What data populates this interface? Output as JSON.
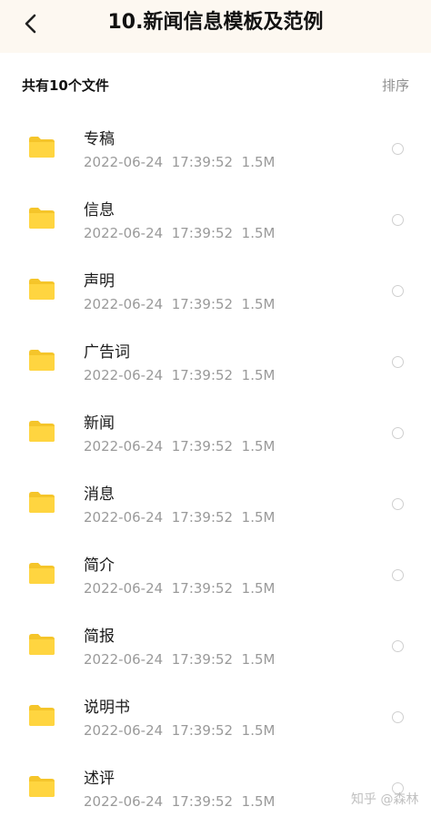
{
  "header": {
    "title": "10.新闻信息模板及范例",
    "back_icon": "chevron-left-icon"
  },
  "summary": {
    "count_text": "共有10个文件",
    "sort_label": "排序"
  },
  "colors": {
    "header_bg": "#fdf8f1",
    "folder": "#ffd540",
    "folder_tab": "#f5c52a",
    "meta_text": "#9a9a9a"
  },
  "files": [
    {
      "name": "专稿",
      "date": "2022-06-24",
      "time": "17:39:52",
      "size": "1.5M",
      "icon": "folder-icon"
    },
    {
      "name": "信息",
      "date": "2022-06-24",
      "time": "17:39:52",
      "size": "1.5M",
      "icon": "folder-icon"
    },
    {
      "name": "声明",
      "date": "2022-06-24",
      "time": "17:39:52",
      "size": "1.5M",
      "icon": "folder-icon"
    },
    {
      "name": "广告词",
      "date": "2022-06-24",
      "time": "17:39:52",
      "size": "1.5M",
      "icon": "folder-icon"
    },
    {
      "name": "新闻",
      "date": "2022-06-24",
      "time": "17:39:52",
      "size": "1.5M",
      "icon": "folder-icon"
    },
    {
      "name": "消息",
      "date": "2022-06-24",
      "time": "17:39:52",
      "size": "1.5M",
      "icon": "folder-icon"
    },
    {
      "name": "简介",
      "date": "2022-06-24",
      "time": "17:39:52",
      "size": "1.5M",
      "icon": "folder-icon"
    },
    {
      "name": "简报",
      "date": "2022-06-24",
      "time": "17:39:52",
      "size": "1.5M",
      "icon": "folder-icon"
    },
    {
      "name": "说明书",
      "date": "2022-06-24",
      "time": "17:39:52",
      "size": "1.5M",
      "icon": "folder-icon"
    },
    {
      "name": "述评",
      "date": "2022-06-24",
      "time": "17:39:52",
      "size": "1.5M",
      "icon": "folder-icon"
    }
  ],
  "watermark": "知乎 @森林"
}
